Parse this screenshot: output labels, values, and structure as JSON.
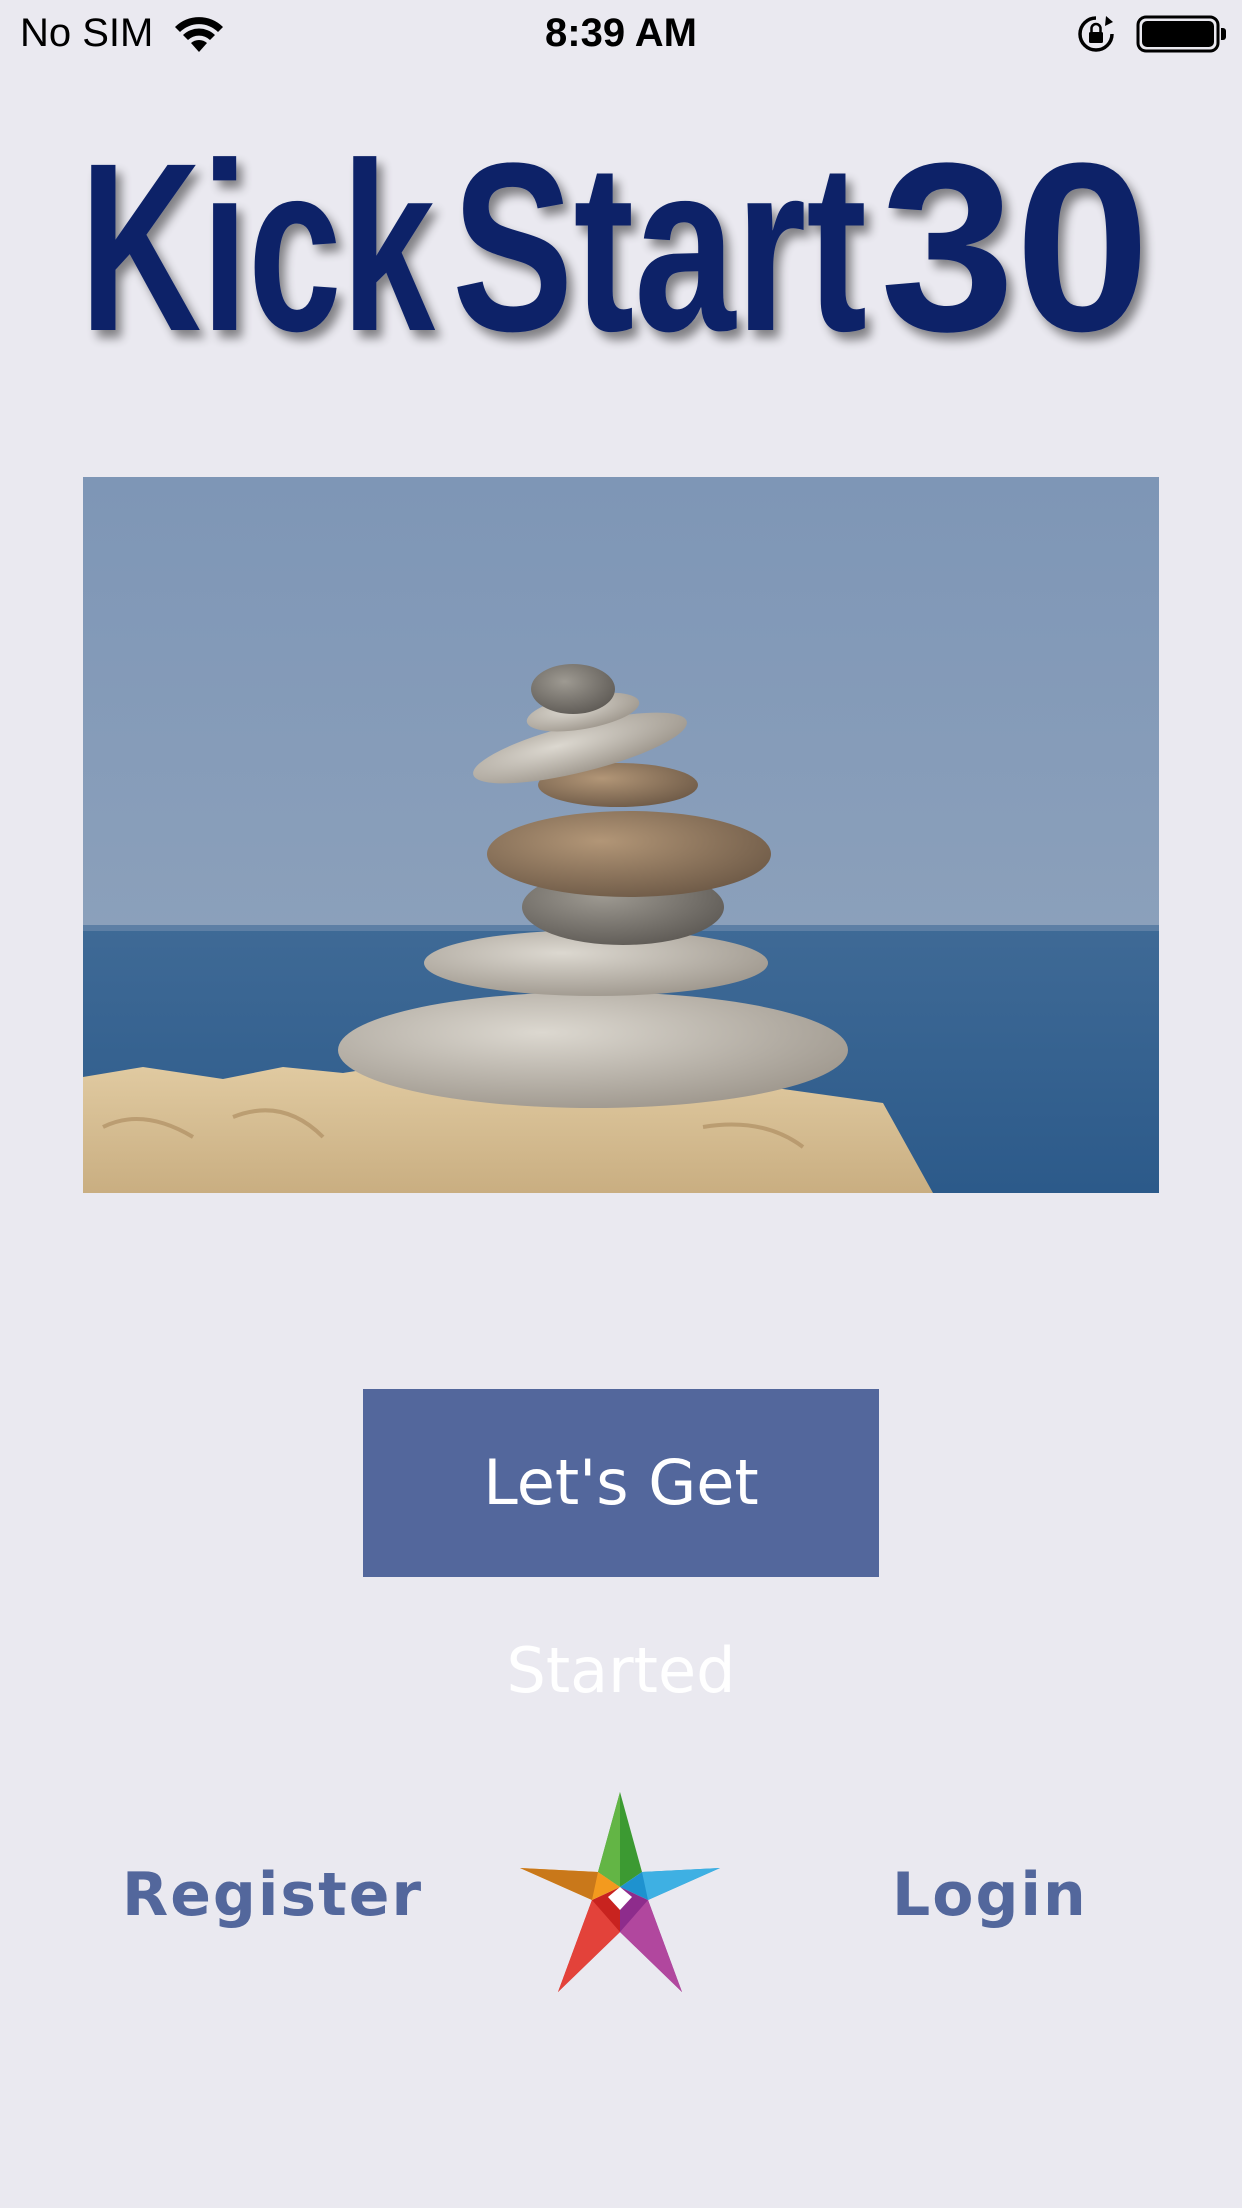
{
  "status_bar": {
    "carrier": "No SIM",
    "time": "8:39 AM",
    "icons": [
      "wifi-icon",
      "rotation-lock-icon",
      "battery-icon"
    ]
  },
  "logo": {
    "text_part1": "Kick",
    "text_part2": "Start",
    "text_part3": "30",
    "color": "#0D2468"
  },
  "hero_image": {
    "description_icon": "stacked-stones-photo"
  },
  "actions": {
    "start_label": "Let's Get Started",
    "register_label": "Register",
    "login_label": "Login"
  },
  "colors": {
    "background": "#EAE9F0",
    "accent": "#53679C",
    "logo": "#0D2468"
  }
}
